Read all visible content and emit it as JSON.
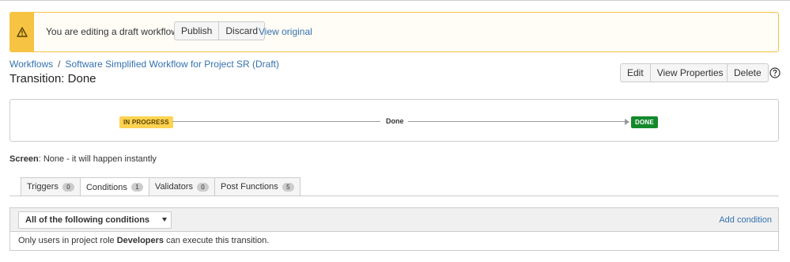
{
  "banner": {
    "message": "You are editing a draft workflow.",
    "publish_label": "Publish",
    "discard_label": "Discard",
    "view_original_label": "View original",
    "accent_color": "#f6c342"
  },
  "breadcrumb": {
    "root": "Workflows",
    "separator": "/",
    "current": "Software Simplified Workflow for Project SR (Draft)"
  },
  "page_title": "Transition: Done",
  "actions": {
    "edit_label": "Edit",
    "view_properties_label": "View Properties",
    "delete_label": "Delete"
  },
  "diagram": {
    "from_status": "IN PROGRESS",
    "transition_name": "Done",
    "to_status": "DONE",
    "from_color": "#ffd351",
    "to_color": "#14892c"
  },
  "screen": {
    "label": "Screen",
    "value": ": None - it will happen instantly"
  },
  "tabs": [
    {
      "label": "Triggers",
      "count": "0"
    },
    {
      "label": "Conditions",
      "count": "1"
    },
    {
      "label": "Validators",
      "count": "0"
    },
    {
      "label": "Post Functions",
      "count": "5"
    }
  ],
  "active_tab": "Conditions",
  "conditions": {
    "select_value": "All of the following conditions",
    "add_condition_label": "Add condition",
    "row_prefix": "Only users in project role ",
    "row_role": "Developers",
    "row_suffix": " can execute this transition."
  }
}
